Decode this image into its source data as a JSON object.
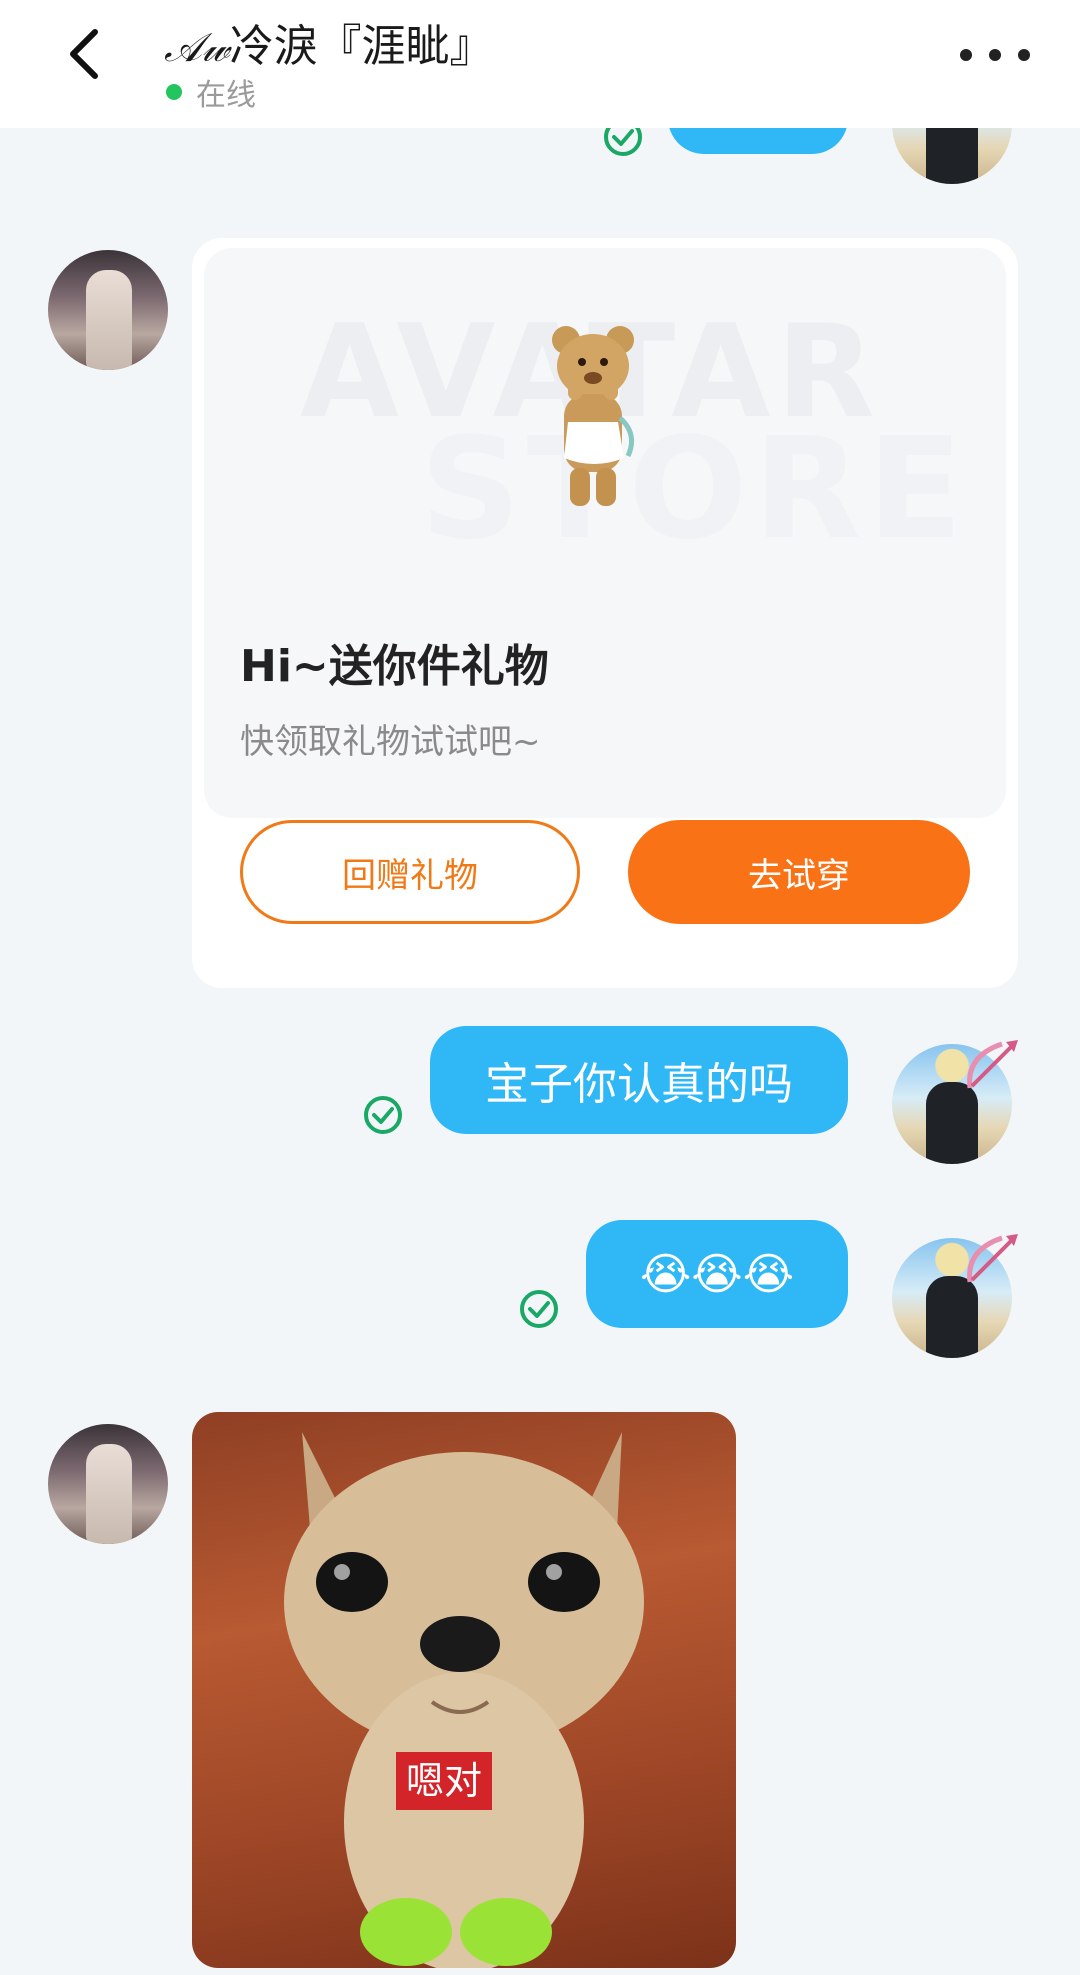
{
  "header": {
    "back_icon": "chevron-left-icon",
    "title_prefix": "𝒜𝓌",
    "title_main": "冷淚『涯眦』",
    "status_text": "在线",
    "status_color": "#22c55e",
    "more_icon": "more-dots-icon"
  },
  "gift_card": {
    "watermark_line1": "AVATAR",
    "watermark_line2": "STORE",
    "title": "Hi~送你件礼物",
    "subtitle": "快领取礼物试试吧~",
    "return_gift_label": "回赠礼物",
    "try_on_label": "去试穿",
    "accent_color": "#f97316"
  },
  "messages": [
    {
      "from": "me",
      "text": "宝子你认真的吗",
      "status": "read"
    },
    {
      "from": "me",
      "text": "😭😭😭",
      "status": "read"
    }
  ],
  "sticker": {
    "caption": "嗯对"
  },
  "colors": {
    "bubble": "#2fb8f5",
    "read_check": "#1aa866",
    "background": "#f3f6f9"
  }
}
